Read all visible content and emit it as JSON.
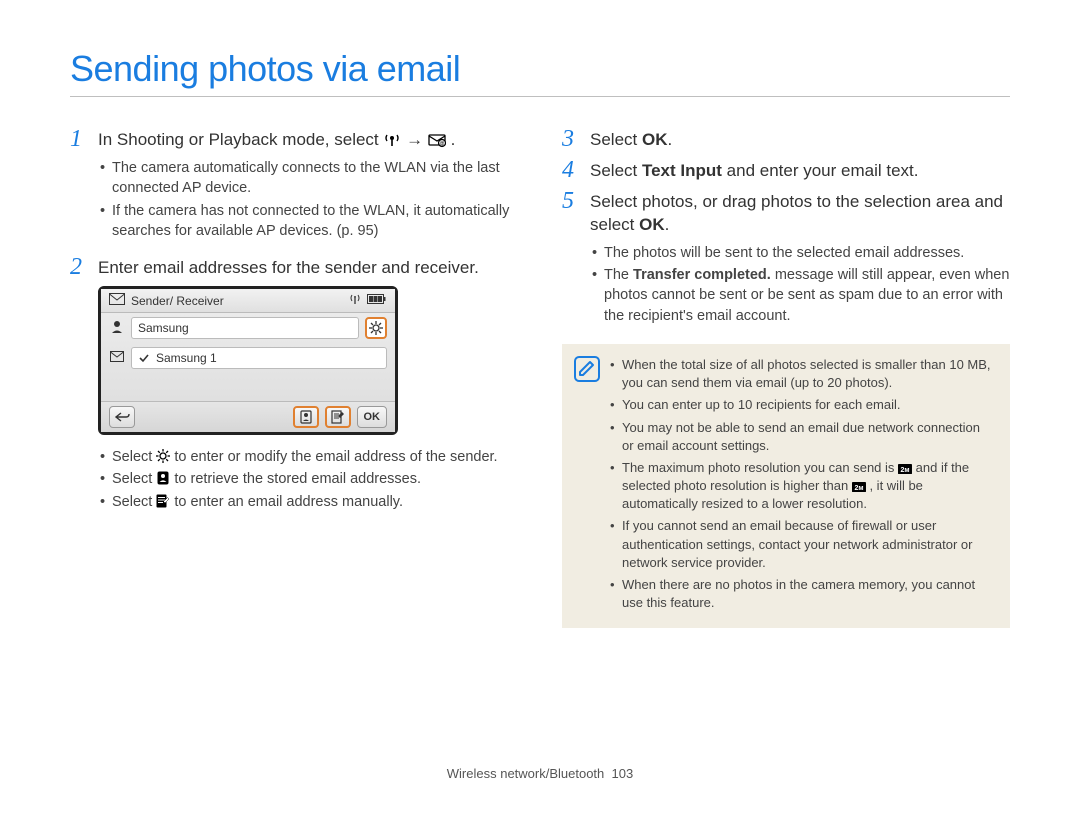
{
  "title": "Sending photos via email",
  "footer_section": "Wireless network/Bluetooth",
  "footer_page": "103",
  "left": {
    "step1": {
      "num": "1",
      "text_a": "In Shooting or Playback mode, select ",
      "text_b": " → ",
      "text_c": ".",
      "bullets": [
        "The camera automatically connects to the WLAN via the last connected AP device.",
        "If the camera has not connected to the WLAN, it automatically searches for available AP devices. (p. 95)"
      ]
    },
    "step2": {
      "num": "2",
      "text": "Enter email addresses for the sender and receiver."
    },
    "lcd": {
      "header_label": "Sender/ Receiver",
      "row1_value": "Samsung",
      "row2_value": "Samsung 1",
      "ok_label": "OK"
    },
    "below_lcd": {
      "b1_a": "Select ",
      "b1_b": " to enter or modify the email address of the sender.",
      "b2_a": "Select ",
      "b2_b": " to retrieve the stored email addresses.",
      "b3_a": "Select ",
      "b3_b": " to enter an email address manually."
    }
  },
  "right": {
    "step3": {
      "num": "3",
      "text_a": "Select ",
      "bold": "OK",
      "text_b": "."
    },
    "step4": {
      "num": "4",
      "text_a": "Select ",
      "bold": "Text Input",
      "text_b": " and enter your email text."
    },
    "step5": {
      "num": "5",
      "text_a": "Select photos, or drag photos to the selection area and select ",
      "bold": "OK",
      "text_b": ".",
      "bullets_b1": "The photos will be sent to the selected email addresses.",
      "bullets_b2_a": "The ",
      "bullets_b2_bold": "Transfer completed.",
      "bullets_b2_b": " message will still appear, even when photos cannot be sent or be sent as spam due to an error with the recipient's email account."
    },
    "note": {
      "n1": "When the total size of all photos selected is smaller than 10 MB, you can send them via email (up to 20 photos).",
      "n2": "You can enter up to 10 recipients for each email.",
      "n3": "You may not be able to send an email due network connection or email account settings.",
      "n4_a": "The maximum photo resolution you can send is ",
      "n4_b": " and if the selected photo resolution is higher than ",
      "n4_c": ", it will be automatically resized to a lower resolution.",
      "n5": "If you cannot send an email because of firewall or user authentication settings, contact your network administrator or network service provider.",
      "n6": "When there are no photos in the camera memory, you cannot use this feature."
    }
  }
}
